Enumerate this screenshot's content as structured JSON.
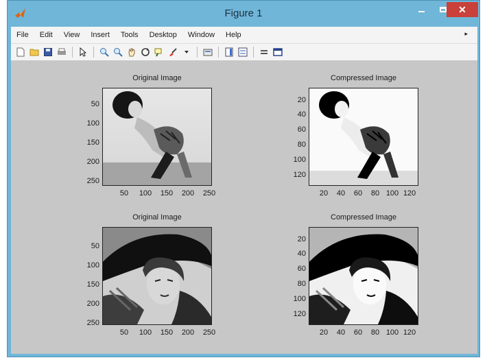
{
  "window": {
    "title": "Figure 1",
    "close_symbol": "✕"
  },
  "menu": [
    "File",
    "Edit",
    "View",
    "Insert",
    "Tools",
    "Desktop",
    "Window",
    "Help"
  ],
  "menu_overflow": "▸",
  "toolbar": [
    "new-file-icon",
    "open-folder-icon",
    "save-icon",
    "print-icon",
    "pointer-icon",
    "zoom-in-icon",
    "zoom-out-icon",
    "pan-icon",
    "rotate-icon",
    "data-cursor-icon",
    "brush-icon",
    "dropdown-icon",
    "link-icon",
    "colorbar-icon",
    "legend-icon",
    "hide-tools-icon",
    "dock-icon"
  ],
  "plots": [
    {
      "title": "Original Image",
      "yticks": [
        "50",
        "100",
        "150",
        "200",
        "250"
      ],
      "xticks": [
        "50",
        "100",
        "150",
        "200",
        "250"
      ],
      "image": "gymnast-orig"
    },
    {
      "title": "Compressed Image",
      "yticks": [
        "20",
        "40",
        "60",
        "80",
        "100",
        "120"
      ],
      "xticks": [
        "20",
        "40",
        "60",
        "80",
        "100",
        "120"
      ],
      "image": "gymnast-comp"
    },
    {
      "title": "Original Image",
      "yticks": [
        "50",
        "100",
        "150",
        "200",
        "250"
      ],
      "xticks": [
        "50",
        "100",
        "150",
        "200",
        "250"
      ],
      "image": "portrait-orig"
    },
    {
      "title": "Compressed Image",
      "yticks": [
        "20",
        "40",
        "60",
        "80",
        "100",
        "120"
      ],
      "xticks": [
        "20",
        "40",
        "60",
        "80",
        "100",
        "120"
      ],
      "image": "portrait-comp"
    }
  ]
}
